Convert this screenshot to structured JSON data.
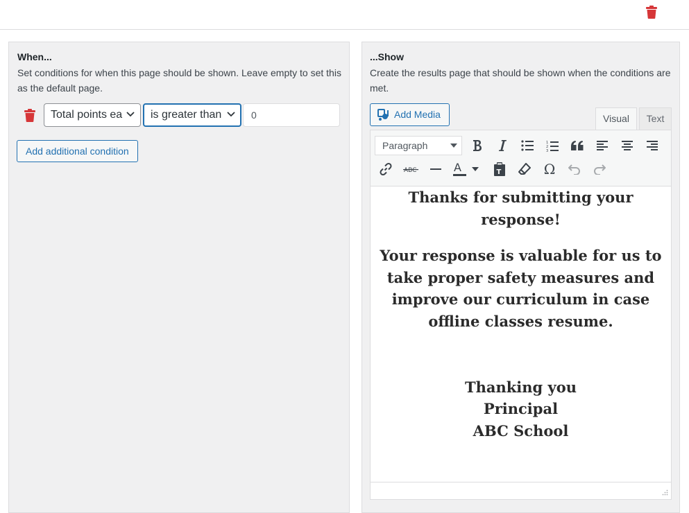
{
  "top": {
    "delete_icon": "trash-icon",
    "delete_color": "#d63638"
  },
  "when": {
    "title": "When...",
    "description": "Set conditions for when this page should be shown. Leave empty to set this as the default page.",
    "condition": {
      "field_value": "Total points ea",
      "operator_value": "is greater than",
      "number_value": "0"
    },
    "add_condition_label": "Add additional condition"
  },
  "show": {
    "title": "...Show",
    "description": "Create the results page that should be shown when the conditions are met.",
    "add_media_label": "Add Media",
    "tabs": [
      {
        "label": "Visual",
        "active": true
      },
      {
        "label": "Text",
        "active": false
      }
    ],
    "format_value": "Paragraph",
    "toolbar_icons": [
      "bold-icon",
      "italic-icon",
      "bullet-list-icon",
      "numbered-list-icon",
      "blockquote-icon",
      "align-left-icon",
      "align-center-icon",
      "align-right-icon",
      "link-icon",
      "strikethrough-icon",
      "horizontal-line-icon",
      "text-color-icon",
      "paste-text-icon",
      "clear-formatting-icon",
      "special-character-icon",
      "undo-icon",
      "redo-icon"
    ],
    "content": {
      "heading_1": "Thanks for submitting your",
      "heading_2": "response!",
      "para_1": "Your response is valuable for us to",
      "para_2": "take proper safety measures and",
      "para_3": "improve our curriculum in case",
      "para_4": "offline classes resume.",
      "sign_1": "Thanking you",
      "sign_2": "Principal",
      "sign_3": "ABC School"
    }
  },
  "colors": {
    "accent": "#2271b1",
    "danger": "#d63638",
    "panel_bg": "#f0f0f1"
  }
}
